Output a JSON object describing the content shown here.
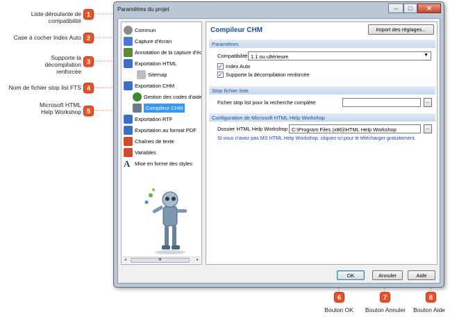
{
  "callouts": [
    {
      "num": "1",
      "label": "Liste déroulante de compatibilité"
    },
    {
      "num": "2",
      "label": "Case à cocher Index Auto"
    },
    {
      "num": "3",
      "label": "Supporte la décompilation renforcée"
    },
    {
      "num": "4",
      "label": "Nom de fichier stop list FTS"
    },
    {
      "num": "5",
      "label": "Microsoft HTML Help Workshop"
    },
    {
      "num": "6",
      "label": "Bouton OK"
    },
    {
      "num": "7",
      "label": "Bouton Annuler"
    },
    {
      "num": "8",
      "label": "Bouton Aide"
    }
  ],
  "window": {
    "title": "Paramètres du projet",
    "controls": {
      "minimize": "–",
      "maximize": "□",
      "close": "✕"
    }
  },
  "tree": {
    "items": [
      {
        "label": "Commun",
        "icon": "gear-icon",
        "color": "#8c8c8c"
      },
      {
        "label": "Capture d'écran",
        "icon": "screenshot-icon",
        "color": "#4a7bd0"
      },
      {
        "label": "Annotation de la capture d'écr",
        "icon": "annotation-icon",
        "color": "#5a8a3a"
      },
      {
        "label": "Exportation HTML",
        "icon": "html-icon",
        "color": "#3a6fc4"
      },
      {
        "label": "Sitemap",
        "icon": "sitemap-icon",
        "color": "#9a9a9a"
      },
      {
        "label": "Exportation CHM",
        "icon": "chm-icon",
        "color": "#3a6fc4"
      },
      {
        "label": "Gestion des codes d'aide",
        "icon": "id-icon",
        "color": "#3b8a2e"
      },
      {
        "label": "Compileur CHM",
        "icon": "compiler-icon",
        "color": "#6a7a8a"
      },
      {
        "label": "Exportation RTF",
        "icon": "rtf-icon",
        "color": "#3a6fc4"
      },
      {
        "label": "Exportation au format PDF",
        "icon": "pdf-icon",
        "color": "#3a6fc4"
      },
      {
        "label": "Chaînes de texte",
        "icon": "strings-icon",
        "color": "#d14a2a"
      },
      {
        "label": "Variables",
        "icon": "variables-icon",
        "color": "#d14a2a"
      },
      {
        "label": "Mise en forme des styles",
        "icon": "styles-icon",
        "color": "#1d3f8a"
      }
    ],
    "scroll_thumb": "III"
  },
  "panel": {
    "title": "Compileur CHM",
    "import_button": "Import des réglages...",
    "params_header": "Paramètres",
    "compat_label": "Compatibilité",
    "compat_value": "1.1 ou ultérieure",
    "index_auto_label": "Index Auto",
    "decompile_label": "Supporte la décompilation renforcée",
    "stoplist_header": "Stop fichier liste",
    "stoplist_label": "Ficher stop list pour la recherche complète",
    "stoplist_value": "",
    "workshop_header": "Configuration de Microsoft HTML Help Workshop",
    "workshop_label": "Dossier HTML Help Workshop",
    "workshop_value": "C:\\Program Files (x86)\\HTML Help Workshop",
    "workshop_link": "Si vous n'avez pas MS HTML Help Workshop, cliquez ici pour le télécharger gratuitement.",
    "browse_label": "..."
  },
  "buttons": {
    "ok": "OK",
    "cancel": "Annuler",
    "help": "Aide"
  },
  "colors": {
    "accent": "#e8542a",
    "header_text": "#1d4e93",
    "selection": "#3399ff",
    "link": "#1a3de0"
  }
}
